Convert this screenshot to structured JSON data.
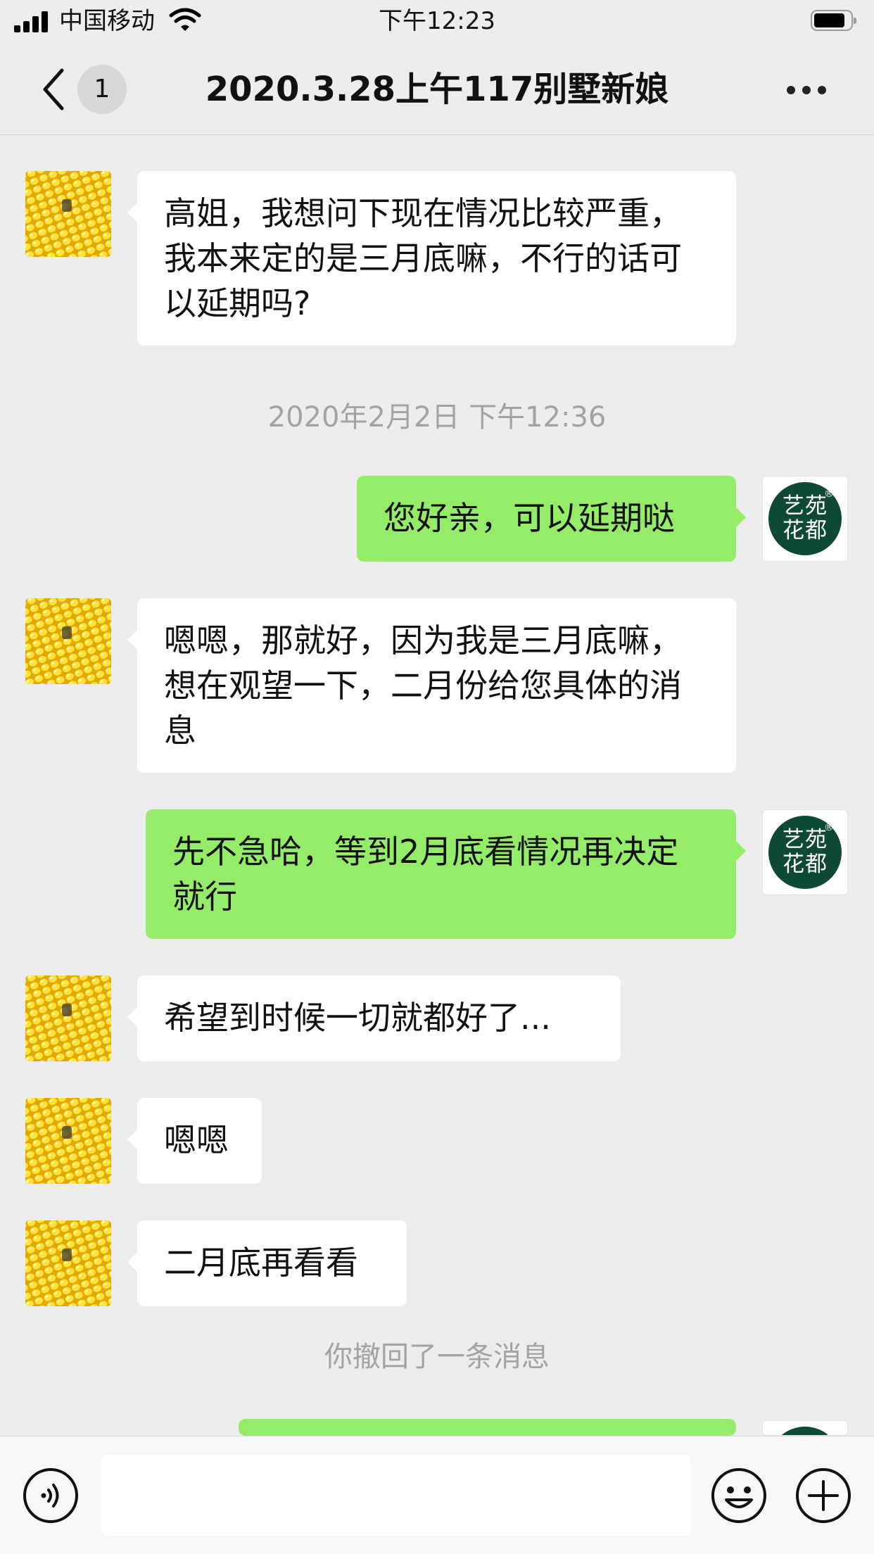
{
  "status_bar": {
    "carrier": "中国移动",
    "time": "下午12:23",
    "battery_level": 0.85
  },
  "header": {
    "unread_count": "1",
    "title": "2020.3.28上午117别墅新娘"
  },
  "contact_logo": {
    "line1": "艺苑",
    "line2": "花都",
    "mark": "®"
  },
  "messages": [
    {
      "side": "in",
      "text": "高姐，我想问下现在情况比较严重，我本来定的是三月底嘛，不行的话可以延期吗?"
    },
    {
      "system": "2020年2月2日 下午12:36"
    },
    {
      "side": "out",
      "text": "您好亲，可以延期哒"
    },
    {
      "side": "in",
      "text": "嗯嗯，那就好，因为我是三月底嘛，想在观望一下，二月份给您具体的消息"
    },
    {
      "side": "out",
      "text": "先不急哈，等到2月底看情况再决定就行"
    },
    {
      "side": "in",
      "text": "希望到时候一切就都好了..."
    },
    {
      "side": "in",
      "text": "嗯嗯"
    },
    {
      "side": "in",
      "text": "二月底再看看"
    },
    {
      "system": "你撤回了一条消息"
    },
    {
      "side": "out",
      "text": ""
    }
  ],
  "input_bar": {
    "text": "",
    "icons": [
      "voice-icon",
      "emoji-icon",
      "plus-icon"
    ]
  },
  "colors": {
    "background": "#ededed",
    "outgoing_bubble": "#95ec69",
    "incoming_bubble": "#ffffff",
    "logo_green": "#0e4a33"
  }
}
